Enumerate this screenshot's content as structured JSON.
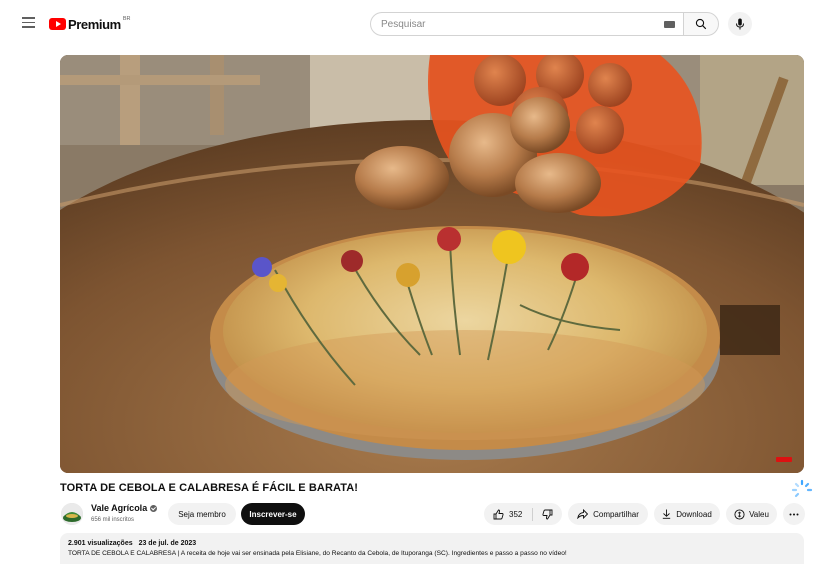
{
  "header": {
    "logo_text": "Premium",
    "logo_country": "BR",
    "search_placeholder": "Pesquisar"
  },
  "video": {
    "title": "TORTA DE CEBOLA E CALABRESA É FÁCIL E BARATA!"
  },
  "channel": {
    "name": "Vale Agrícola",
    "subscribers": "656 mil inscritos",
    "join_label": "Seja membro",
    "subscribe_label": "Inscrever-se"
  },
  "actions": {
    "like_count": "352",
    "share_label": "Compartilhar",
    "download_label": "Download",
    "thanks_label": "Valeu"
  },
  "description": {
    "views": "2.901 visualizações",
    "date": "23 de jul. de 2023",
    "text": "TORTA DE CEBOLA E CALABRESA | A receita de hoje vai ser ensinada pela Elisiane, do Recanto da Cebola, de Ituporanga (SC). Ingredientes e passo a passo no vídeo!"
  },
  "colors": {
    "brand_red": "#ff0000",
    "subscribe_bg": "#0f0f0f",
    "pill_bg": "#f2f2f2",
    "spinner": "#3ea6ff"
  },
  "icons": [
    "menu-icon",
    "youtube-logo-icon",
    "keyboard-icon",
    "search-icon",
    "mic-icon",
    "verified-icon",
    "like-icon",
    "dislike-icon",
    "share-icon",
    "download-icon",
    "thanks-icon",
    "more-icon",
    "spinner-icon"
  ]
}
